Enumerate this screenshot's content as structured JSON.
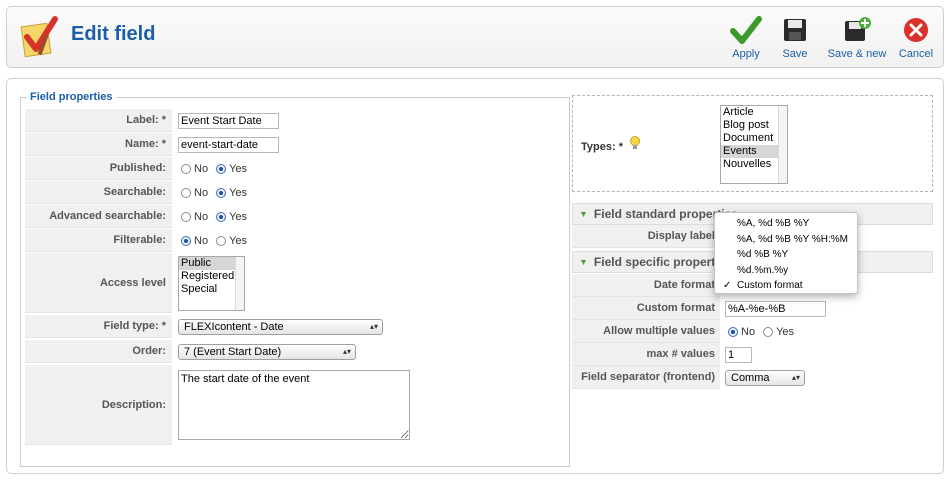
{
  "toolbar": {
    "title": "Edit field",
    "buttons": [
      {
        "label": "Apply",
        "icon": "check-icon"
      },
      {
        "label": "Save",
        "icon": "floppy-disk-icon"
      },
      {
        "label": "Save & new",
        "icon": "floppy-disk-plus-icon"
      },
      {
        "label": "Cancel",
        "icon": "cancel-icon"
      }
    ]
  },
  "field_properties": {
    "legend": "Field properties",
    "label": {
      "label": "Label: *",
      "value": "Event Start Date"
    },
    "name": {
      "label": "Name: *",
      "value": "event-start-date"
    },
    "published": {
      "label": "Published:",
      "options": [
        "No",
        "Yes"
      ],
      "selected": "Yes"
    },
    "searchable": {
      "label": "Searchable:",
      "options": [
        "No",
        "Yes"
      ],
      "selected": "Yes"
    },
    "advanced_searchable": {
      "label": "Advanced searchable:",
      "options": [
        "No",
        "Yes"
      ],
      "selected": "Yes"
    },
    "filterable": {
      "label": "Filterable:",
      "options": [
        "No",
        "Yes"
      ],
      "selected": "No"
    },
    "access_level": {
      "label": "Access level",
      "options": [
        "Public",
        "Registered",
        "Special"
      ],
      "selected": "Public"
    },
    "field_type": {
      "label": "Field type: *",
      "value": "FLEXIcontent - Date"
    },
    "order": {
      "label": "Order:",
      "value": "7 (Event Start Date)"
    },
    "description": {
      "label": "Description:",
      "value": "The start date of the event"
    }
  },
  "types": {
    "label": "Types: *",
    "options": [
      "Article",
      "Blog post",
      "Document",
      "Events",
      "Nouvelles"
    ],
    "selected": "Events"
  },
  "standard": {
    "title": "Field standard properties",
    "display_label": "Display label"
  },
  "specific": {
    "title": "Field specific properties",
    "date_format_label": "Date format",
    "custom_format_label": "Custom format",
    "custom_format_value": "%A-%e-%B",
    "allow_multiple": {
      "label": "Allow multiple values",
      "options": [
        "No",
        "Yes"
      ],
      "selected": "No"
    },
    "max_values": {
      "label": "max # values",
      "value": "1"
    },
    "separator": {
      "label": "Field separator (frontend)",
      "value": "Comma"
    }
  },
  "date_format_popup": {
    "options": [
      "%A, %d %B %Y",
      "%A, %d %B %Y %H:%M",
      "%d %B %Y",
      "%d.%m.%y",
      "Custom format"
    ],
    "checked": "Custom format"
  }
}
